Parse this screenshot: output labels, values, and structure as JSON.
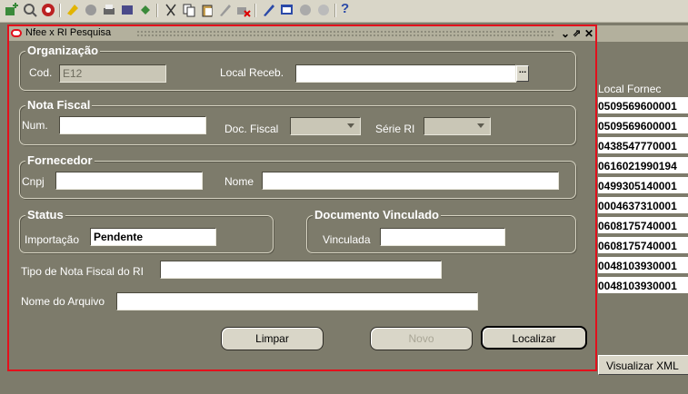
{
  "toolbar": {
    "icons": [
      "new-record-icon",
      "find-icon",
      "navigator-icon",
      "save-icon",
      "next-step-icon",
      "print-icon",
      "close-form-icon",
      "cut-icon",
      "copy-icon",
      "paste-icon",
      "clear-record-icon",
      "delete-record-icon",
      "edit-field-icon",
      "zoom-icon",
      "translations-icon",
      "attachments-icon",
      "folder-icon"
    ],
    "help": "?"
  },
  "background_window": {
    "column_header": "Local Fornec",
    "rows": [
      "0509569600001",
      "0509569600001",
      "0438547770001",
      "0616021990194",
      "0499305140001",
      "0004637310001",
      "0608175740001",
      "0608175740001",
      "0048103930001",
      "0048103930001"
    ],
    "button_label": "Visualizar XML"
  },
  "dialog": {
    "title": "Nfee x RI Pesquisa",
    "organizacao": {
      "group_title": "Organização",
      "cod_label": "Cod.",
      "cod_value": "E12",
      "local_receb_label": "Local Receb.",
      "local_receb_value": "",
      "lov_label": "..."
    },
    "nota_fiscal": {
      "group_title": "Nota Fiscal",
      "num_label": "Num.",
      "num_value": "",
      "doc_fiscal_label": "Doc. Fiscal",
      "doc_fiscal_value": "",
      "serie_ri_label": "Série RI",
      "serie_ri_value": ""
    },
    "fornecedor": {
      "group_title": "Fornecedor",
      "cnpj_label": "Cnpj",
      "cnpj_value": "",
      "nome_label": "Nome",
      "nome_value": ""
    },
    "status": {
      "group_title": "Status",
      "importacao_label": "Importação",
      "importacao_value": "Pendente"
    },
    "documento_vinculado": {
      "group_title": "Documento Vinculado",
      "vinculada_label": "Vinculada",
      "vinculada_value": ""
    },
    "tipo_nota_label": "Tipo de Nota Fiscal do RI",
    "tipo_nota_value": "",
    "nome_arquivo_label": "Nome do Arquivo",
    "nome_arquivo_value": "",
    "buttons": {
      "limpar": "Limpar",
      "novo": "Novo",
      "localizar": "Localizar"
    }
  },
  "colors": {
    "dialog_border": "#e3101c",
    "background": "#7d7b6b",
    "titlebar": "#b3b09d"
  }
}
